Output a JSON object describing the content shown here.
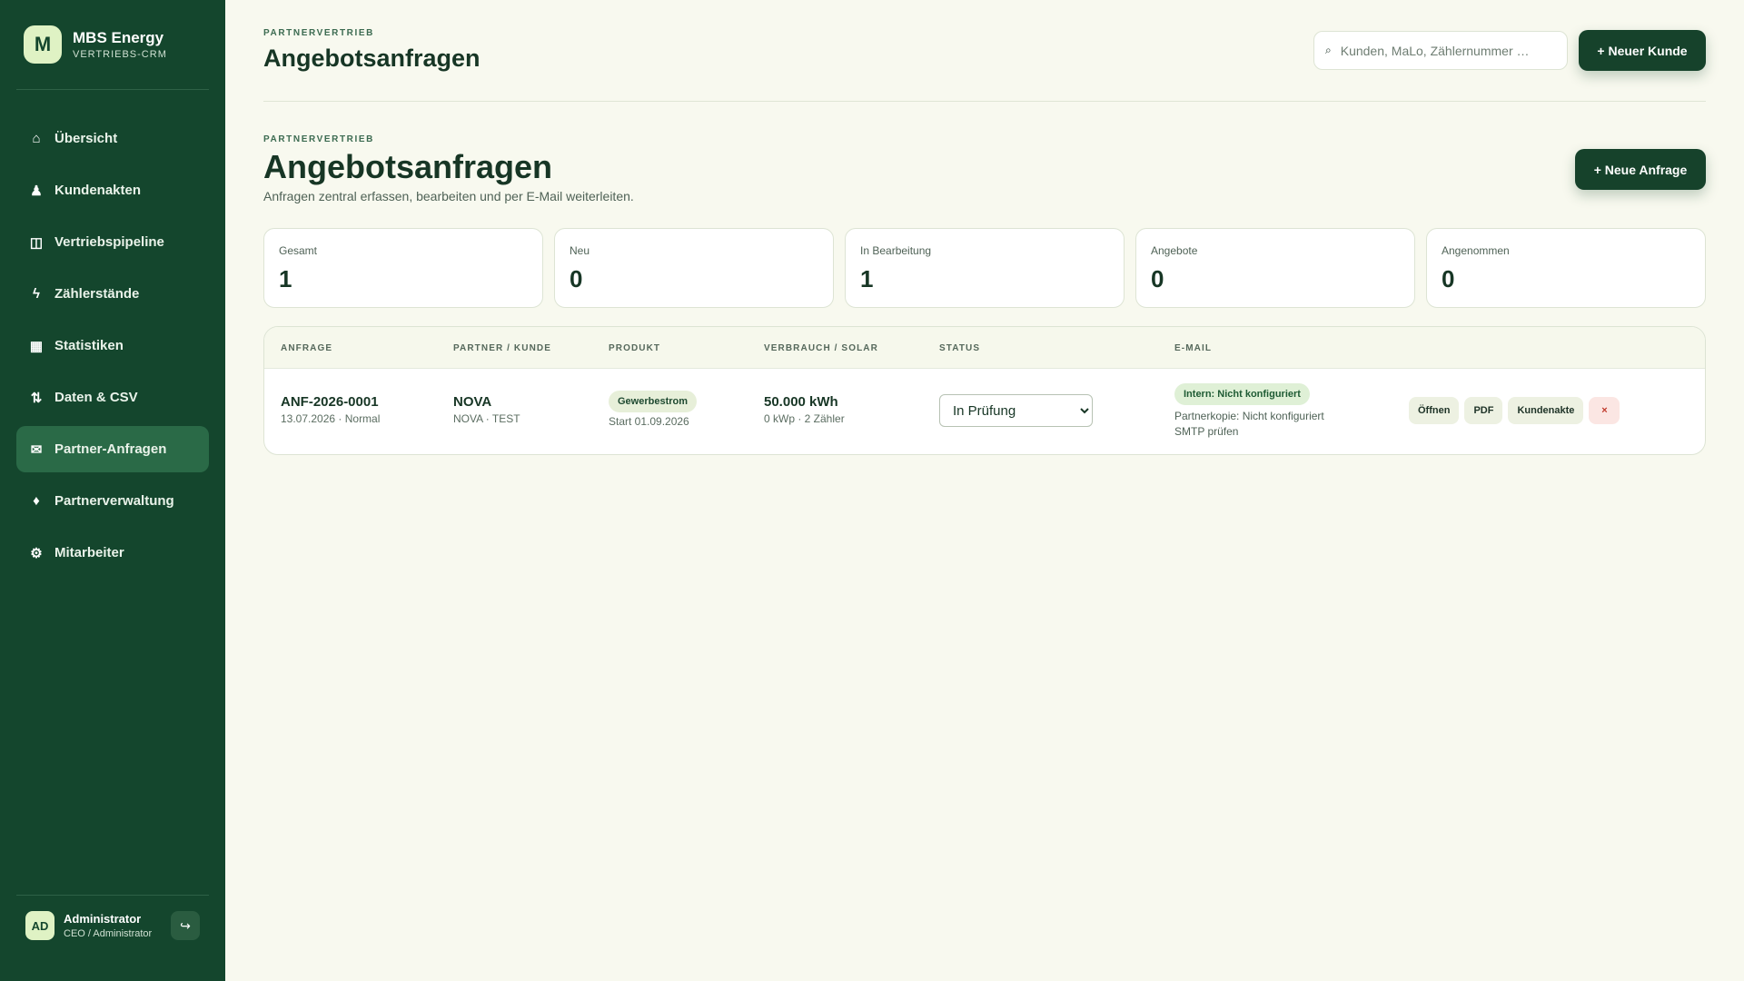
{
  "brand": {
    "logo_letter": "M",
    "name": "MBS Energy",
    "subtitle": "VERTRIEBS-CRM"
  },
  "sidebar": {
    "items": [
      {
        "icon": "⌂",
        "label": "Übersicht"
      },
      {
        "icon": "♟",
        "label": "Kundenakten"
      },
      {
        "icon": "◫",
        "label": "Vertriebspipeline"
      },
      {
        "icon": "ϟ",
        "label": "Zählerstände"
      },
      {
        "icon": "▦",
        "label": "Statistiken"
      },
      {
        "icon": "⇅",
        "label": "Daten & CSV"
      },
      {
        "icon": "✉",
        "label": "Partner-Anfragen"
      },
      {
        "icon": "♦",
        "label": "Partnerverwaltung"
      },
      {
        "icon": "⚙",
        "label": "Mitarbeiter"
      }
    ],
    "active_index": 6
  },
  "user": {
    "initials": "AD",
    "name": "Administrator",
    "role": "CEO / Administrator",
    "logout_icon": "↪"
  },
  "topbar": {
    "eyebrow": "PARTNERVERTRIEB",
    "title": "Angebotsanfragen",
    "search_placeholder": "Kunden, MaLo, Zählernummer …",
    "search_icon": "⌕",
    "new_customer_label": "+ Neuer Kunde"
  },
  "section": {
    "eyebrow": "PARTNERVERTRIEB",
    "title": "Angebotsanfragen",
    "subtitle": "Anfragen zentral erfassen, bearbeiten und per E-Mail weiterleiten.",
    "new_request_label": "+ Neue Anfrage"
  },
  "stats": [
    {
      "label": "Gesamt",
      "value": "1"
    },
    {
      "label": "Neu",
      "value": "0"
    },
    {
      "label": "In Bearbeitung",
      "value": "1"
    },
    {
      "label": "Angebote",
      "value": "0"
    },
    {
      "label": "Angenommen",
      "value": "0"
    }
  ],
  "table": {
    "headers": [
      "ANFRAGE",
      "PARTNER / KUNDE",
      "PRODUKT",
      "VERBRAUCH / SOLAR",
      "STATUS",
      "E-MAIL"
    ],
    "rows": [
      {
        "id": "ANF-2026-0001",
        "meta": "13.07.2026 · Normal",
        "partner": "NOVA",
        "customer": "NOVA · TEST",
        "product": "Gewerbestrom",
        "start": "Start 01.09.2026",
        "consumption": "50.000 kWh",
        "solar": "0 kWp · 2 Zähler",
        "status": "In Prüfung",
        "mail_badge": "Intern: Nicht konfiguriert",
        "mail_copy": "Partnerkopie: Nicht konfiguriert",
        "mail_smtp": "SMTP prüfen",
        "actions": {
          "open": "Öffnen",
          "pdf": "PDF",
          "file": "Kundenakte",
          "delete": "×"
        }
      }
    ]
  },
  "colors": {
    "sidebar": "#14462d",
    "accent": "#16422b",
    "background": "#f8f9ef",
    "active_nav": "#2a6a47"
  }
}
